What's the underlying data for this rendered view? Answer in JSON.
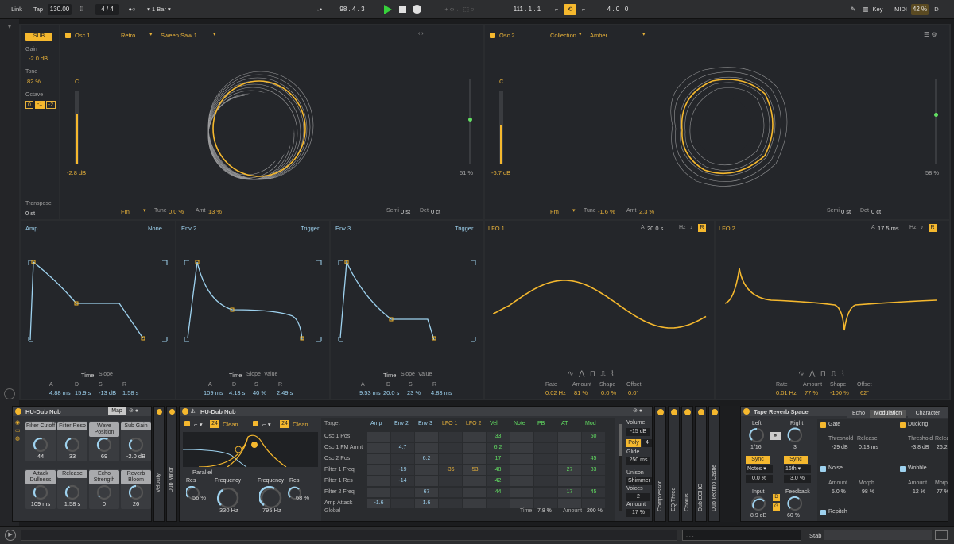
{
  "transport": {
    "link": "Link",
    "tap": "Tap",
    "tempo": "130.00",
    "sig_num": "4",
    "sig_sep": "/",
    "sig_den": "4",
    "metro": "1 Bar",
    "position": "98 .  4 .  3",
    "loop_start": "111 .  1 .  1",
    "loop_len": "4 .  0 .  0",
    "key": "Key",
    "midi": "MIDI",
    "cpu": "42 %",
    "cpu_d": "D"
  },
  "sub": {
    "button": "SUB",
    "gain_label": "Gain",
    "gain": "-2.0 dB",
    "tone_label": "Tone",
    "tone": "82 %",
    "octave_label": "Octave",
    "octaves": [
      "0",
      "-1",
      "-2"
    ],
    "transpose_label": "Transpose",
    "transpose": "0 st"
  },
  "osc1": {
    "title": "Osc 1",
    "bank": "Retro",
    "wave": "Sweep Saw 1",
    "pitch": "C",
    "level": "-2.8 dB",
    "pos": "51 %",
    "fm": "Fm",
    "tune_label": "Tune",
    "tune": "0.0 %",
    "amt_label": "Amt",
    "amt": "13 %",
    "semi_label": "Semi",
    "semi": "0 st",
    "det_label": "Det",
    "det": "0 ct"
  },
  "osc2": {
    "title": "Osc 2",
    "bank": "Collection",
    "wave": "Amber",
    "pitch": "C",
    "level": "-6.7 dB",
    "pos": "58 %",
    "fm": "Fm",
    "tune_label": "Tune",
    "tune": "-1.6 %",
    "amt_label": "Amt",
    "amt": "2.3 %",
    "semi_label": "Semi",
    "semi": "0 st",
    "det_label": "Det",
    "det": "0 ct"
  },
  "env": {
    "tab_time": "Time",
    "tab_slope": "Slope",
    "tab_value": "Value",
    "a": "A",
    "d": "D",
    "s": "S",
    "r": "R",
    "amp": {
      "title": "Amp",
      "mode": "None",
      "A": "4.88 ms",
      "D": "15.9 s",
      "S": "-13 dB",
      "R": "1.58 s"
    },
    "env2": {
      "title": "Env 2",
      "mode": "Trigger",
      "A": "109 ms",
      "D": "4.13 s",
      "S": "40 %",
      "R": "2.49 s"
    },
    "env3": {
      "title": "Env 3",
      "mode": "Trigger",
      "A": "9.53 ms",
      "D": "20.0 s",
      "S": "23 %",
      "R": "4.83 ms"
    }
  },
  "lfo": {
    "rate_label": "Rate",
    "amount_label": "Amount",
    "shape_label": "Shape",
    "offset_label": "Offset",
    "a": "A",
    "hz": "Hz",
    "r": "R",
    "lfo1": {
      "title": "LFO 1",
      "a_val": "20.0 s",
      "rate": "0.02 Hz",
      "amount": "81 %",
      "shape": "0.0 %",
      "offset": "0.0°"
    },
    "lfo2": {
      "title": "LFO 2",
      "a_val": "17.5 ms",
      "rate": "0.01 Hz",
      "amount": "77 %",
      "shape": "-100 %",
      "offset": "62°"
    }
  },
  "rack": {
    "title": "HU-Dub Nub",
    "map": "Map",
    "macros": [
      {
        "label": "Filter Cutoff",
        "value": "44"
      },
      {
        "label": "Filter Reso",
        "value": "33"
      },
      {
        "label": "Wave Position",
        "value": "69"
      },
      {
        "label": "Sub Gain",
        "value": "-2.0 dB"
      },
      {
        "label": "Attack Dullness",
        "value": "109 ms"
      },
      {
        "label": "Release",
        "value": "1.58 s"
      },
      {
        "label": "Echo Strength",
        "value": "0"
      },
      {
        "label": "Reverb Bloom",
        "value": "26"
      }
    ]
  },
  "side1": {
    "velocity": "Velocity",
    "dub_minor": "Dub Minor"
  },
  "synth": {
    "title": "HU-Dub Nub",
    "filter1_num": "24",
    "filter1_type": "Clean",
    "filter2_num": "24",
    "filter2_type": "Clean",
    "routing": "Parallel",
    "res1_label": "Res",
    "res1": "56 %",
    "freq1_label": "Frequency",
    "freq1": "330 Hz",
    "freq2_label": "Frequency",
    "freq2": "795 Hz",
    "res2_label": "Res",
    "res2": "68 %",
    "matrix": {
      "target_label": "Target",
      "cols": [
        "Amp",
        "Env 2",
        "Env 3",
        "LFO 1",
        "LFO 2",
        "Vel",
        "Note",
        "PB",
        "AT",
        "Mod"
      ],
      "rows": [
        {
          "name": "Osc 1 Pos",
          "cells": {
            "5": "33",
            "9": "50"
          }
        },
        {
          "name": "Osc 1 FM Amnt",
          "cells": {
            "1": "4.7",
            "5": "6.2"
          }
        },
        {
          "name": "Osc 2 Pos",
          "cells": {
            "2": "6.2",
            "5": "17",
            "9": "45"
          }
        },
        {
          "name": "Filter 1 Freq",
          "cells": {
            "1": "-19",
            "3": "-36",
            "4": "-53",
            "5": "48",
            "8": "27",
            "9": "83"
          }
        },
        {
          "name": "Filter 1 Res",
          "cells": {
            "1": "-14",
            "5": "42"
          }
        },
        {
          "name": "Filter 2 Freq",
          "cells": {
            "2": "67",
            "5": "44",
            "8": "17",
            "9": "45"
          }
        },
        {
          "name": "Amp Attack",
          "cells": {
            "0": "-1.6",
            "2": "1.6"
          }
        }
      ],
      "global": "Global",
      "time_label": "Time",
      "time": "7.8 %",
      "amount_label": "Amount",
      "amount": "200 %"
    },
    "volume_label": "Volume",
    "volume": "-15 dB",
    "poly": "Poly",
    "voices_n": "4",
    "glide_label": "Glide",
    "glide": "250 ms",
    "unison_label": "Unison",
    "unison": "Shimmer",
    "voices_label": "Voices",
    "voices": "2",
    "amount_label": "Amount",
    "amount": "17 %"
  },
  "fx_strips": [
    "Compressor",
    "EQ Three",
    "Chorus",
    "Dub ECHO",
    "Dub Techno Castle"
  ],
  "reverb": {
    "title": "Tape Reverb Space",
    "tab_echo": "Echo",
    "tab_mod": "Modulation",
    "tab_char": "Character",
    "left_label": "Left",
    "left": "1/16",
    "right_label": "Right",
    "right": "3",
    "sync": "Sync",
    "notes": "Notes",
    "sixteenth": "16th",
    "offset_l": "0.0 %",
    "offset_r": "3.0 %",
    "input_label": "Input",
    "input": "8.9 dB",
    "feedback_label": "Feedback",
    "feedback": "60 %",
    "d": "D",
    "g": "G",
    "gate": {
      "title": "Gate",
      "thr_label": "Threshold",
      "thr": "-29 dB",
      "rel_label": "Release",
      "rel": "0.18 ms"
    },
    "ducking": {
      "title": "Ducking",
      "thr_label": "Threshold",
      "thr": "-3.8 dB",
      "rel_label": "Release",
      "rel": "26.2"
    },
    "noise": {
      "title": "Noise",
      "amt_label": "Amount",
      "amt": "5.0 %",
      "morph_label": "Morph",
      "morph": "98 %"
    },
    "wobble": {
      "title": "Wobble",
      "amt_label": "Amount",
      "amt": "12 %",
      "morph_label": "Morph",
      "morph": "77 %"
    },
    "repitch": "Repitch"
  },
  "status": {
    "track": "Stab"
  }
}
